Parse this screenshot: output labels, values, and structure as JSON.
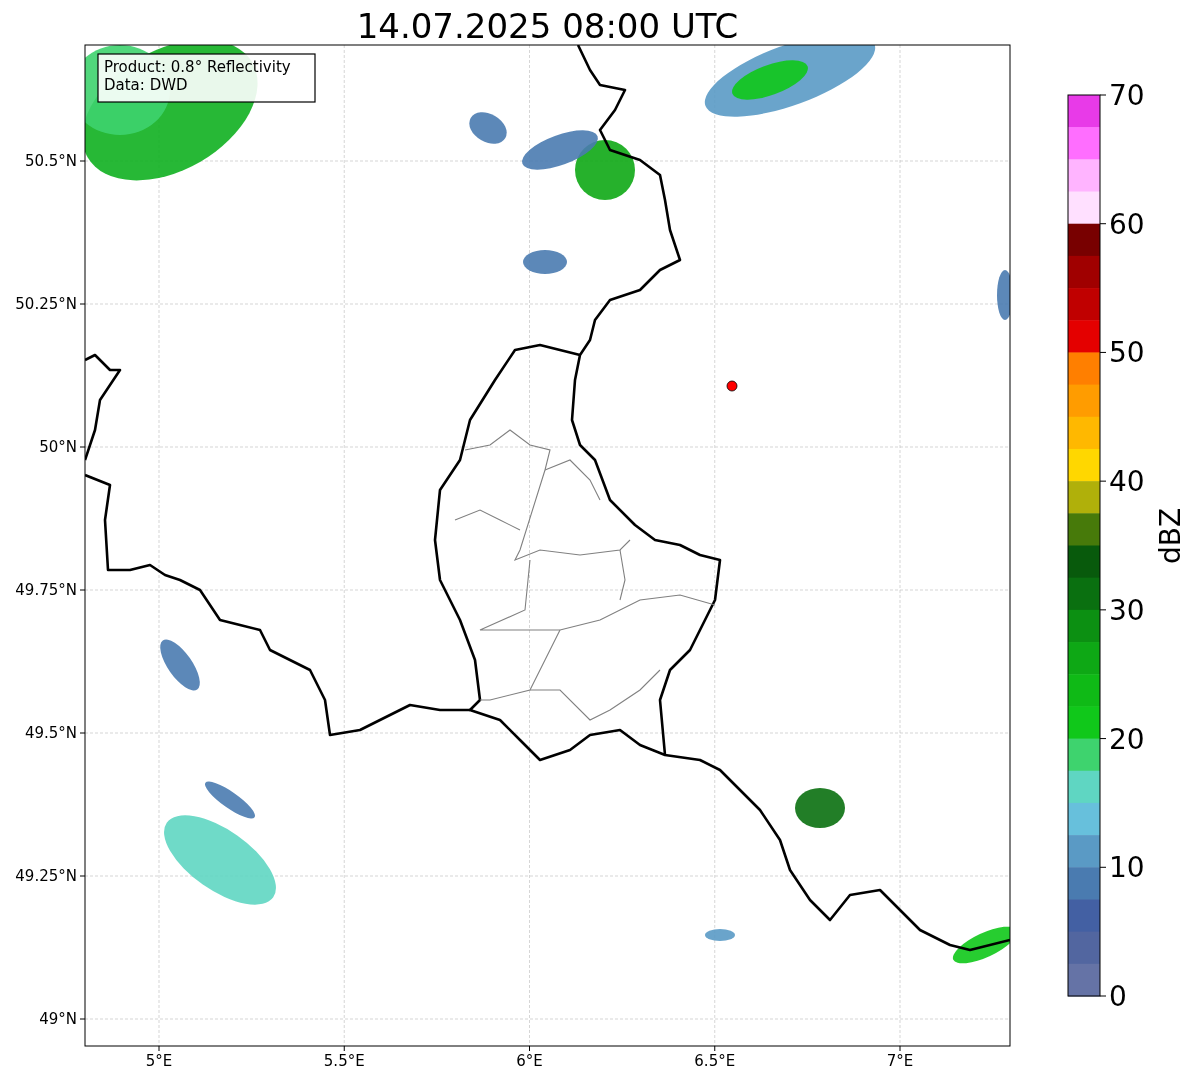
{
  "title": "14.07.2025 08:00 UTC",
  "map": {
    "x_ticks": [
      "5°E",
      "5.5°E",
      "6°E",
      "6.5°E",
      "7°E"
    ],
    "y_ticks": [
      "50.5°N",
      "50.25°N",
      "50°N",
      "49.75°N",
      "49.5°N",
      "49.25°N",
      "49°N"
    ],
    "annotation": [
      "Product: 0.8° Reflectivity",
      "Data: DWD"
    ]
  },
  "colorbar": {
    "label": "dBZ",
    "ticks": [
      "70",
      "60",
      "50",
      "40",
      "30",
      "20",
      "10",
      "0"
    ],
    "segments": [
      {
        "color": "#e83ae8"
      },
      {
        "color": "#ff6eff"
      },
      {
        "color": "#ffb4ff"
      },
      {
        "color": "#ffe0ff"
      },
      {
        "color": "#780000"
      },
      {
        "color": "#a00000"
      },
      {
        "color": "#c00000"
      },
      {
        "color": "#e40000"
      },
      {
        "color": "#ff7f00"
      },
      {
        "color": "#ff9c00"
      },
      {
        "color": "#ffb800"
      },
      {
        "color": "#ffd700"
      },
      {
        "color": "#b0b00a"
      },
      {
        "color": "#477a0a"
      },
      {
        "color": "#085a0c"
      },
      {
        "color": "#0a7010"
      },
      {
        "color": "#0c9012"
      },
      {
        "color": "#0ea815"
      },
      {
        "color": "#0fba16"
      },
      {
        "color": "#10c81a"
      },
      {
        "color": "#3ed36e"
      },
      {
        "color": "#5fd6c2"
      },
      {
        "color": "#67c0dc"
      },
      {
        "color": "#5a9ac5"
      },
      {
        "color": "#4a7bb0"
      },
      {
        "color": "#4360a3"
      },
      {
        "color": "#5266a0"
      },
      {
        "color": "#6573a6"
      }
    ]
  }
}
